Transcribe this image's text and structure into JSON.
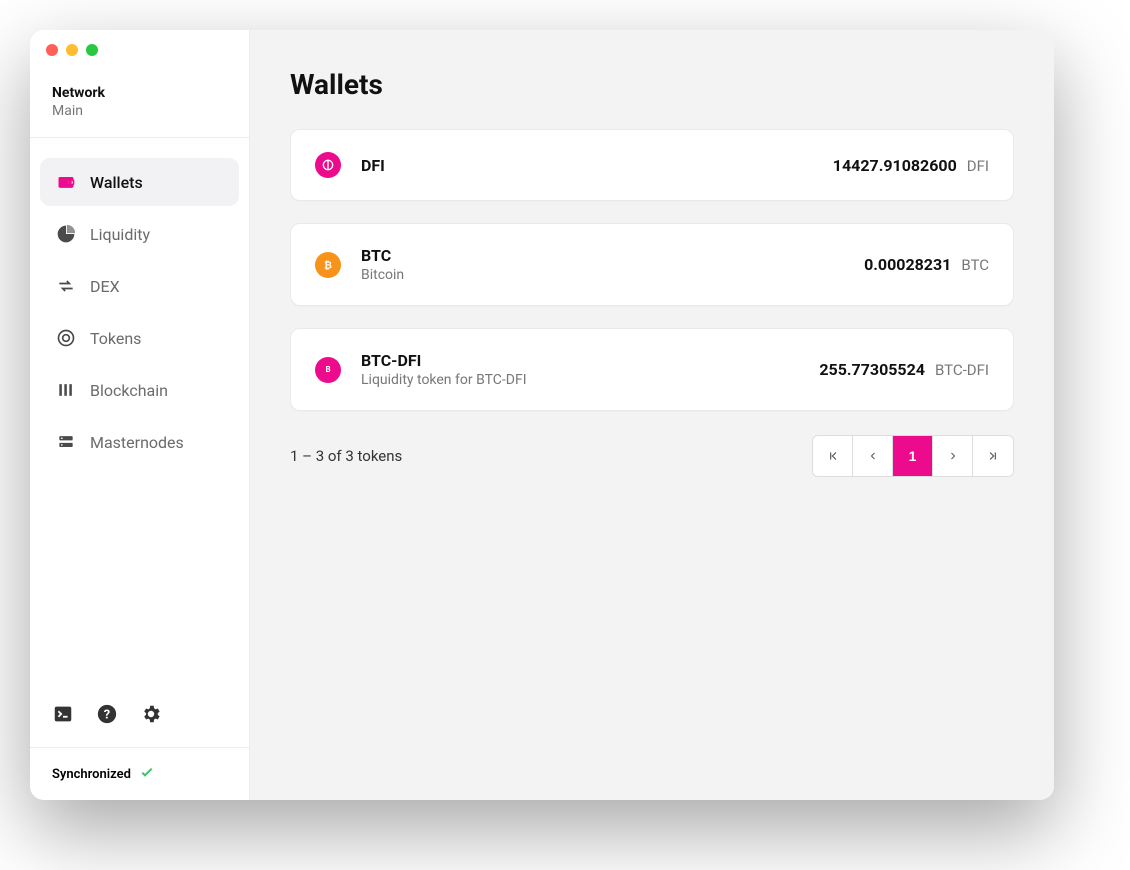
{
  "colors": {
    "accent": "#ec0a8d",
    "btc": "#f7931a"
  },
  "network": {
    "label": "Network",
    "value": "Main"
  },
  "sidebar": {
    "items": [
      {
        "label": "Wallets",
        "icon": "wallet-icon",
        "active": true
      },
      {
        "label": "Liquidity",
        "icon": "pie-icon",
        "active": false
      },
      {
        "label": "DEX",
        "icon": "swap-icon",
        "active": false
      },
      {
        "label": "Tokens",
        "icon": "token-icon",
        "active": false
      },
      {
        "label": "Blockchain",
        "icon": "bars-icon",
        "active": false
      },
      {
        "label": "Masternodes",
        "icon": "server-icon",
        "active": false
      }
    ]
  },
  "bottom": {
    "console": "console-icon",
    "help": "help-icon",
    "settings": "settings-icon"
  },
  "sync": {
    "label": "Synchronized"
  },
  "page": {
    "title": "Wallets"
  },
  "wallets": [
    {
      "symbol": "DFI",
      "subtitle": "",
      "amount": "14427.91082600",
      "unit": "DFI",
      "iconColor": "#ec0a8d",
      "iconKey": "dfi"
    },
    {
      "symbol": "BTC",
      "subtitle": "Bitcoin",
      "amount": "0.00028231",
      "unit": "BTC",
      "iconColor": "#f7931a",
      "iconKey": "btc"
    },
    {
      "symbol": "BTC-DFI",
      "subtitle": "Liquidity token for BTC-DFI",
      "amount": "255.77305524",
      "unit": "BTC-DFI",
      "iconColor": "#ec0a8d",
      "iconKey": "lp"
    }
  ],
  "pagination": {
    "summary": "1 – 3 of 3 tokens",
    "current": "1"
  }
}
